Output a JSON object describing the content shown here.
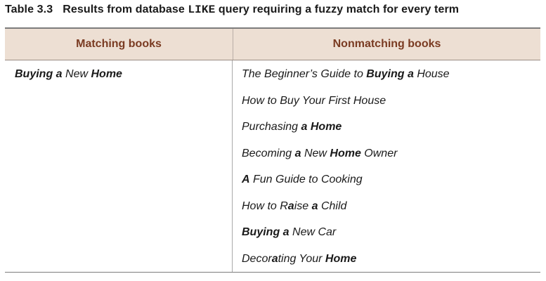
{
  "caption": {
    "number": "Table 3.3",
    "text_before": "Results from database ",
    "code": "LIKE",
    "text_after": " query requiring a fuzzy match for every term"
  },
  "table": {
    "headers": [
      "Matching books",
      "Nonmatching books"
    ],
    "matching": [
      [
        [
          "Buying",
          true
        ],
        [
          " ",
          false
        ],
        [
          "a",
          true
        ],
        [
          " New ",
          false
        ],
        [
          "Home",
          true
        ]
      ]
    ],
    "nonmatching": [
      [
        [
          "The Beginner’s Guide to ",
          false
        ],
        [
          "Buying",
          true
        ],
        [
          " ",
          false
        ],
        [
          "a",
          true
        ],
        [
          " House",
          false
        ]
      ],
      [
        [
          "How to Buy Your First House",
          false
        ]
      ],
      [
        [
          "Purchasing ",
          false
        ],
        [
          "a",
          true
        ],
        [
          " ",
          false
        ],
        [
          "Home",
          true
        ]
      ],
      [
        [
          "Becoming ",
          false
        ],
        [
          "a",
          true
        ],
        [
          " New ",
          false
        ],
        [
          "Home",
          true
        ],
        [
          " Owner",
          false
        ]
      ],
      [
        [
          "A",
          true
        ],
        [
          " Fun Guide to Cooking",
          false
        ]
      ],
      [
        [
          "How to R",
          false
        ],
        [
          "a",
          true
        ],
        [
          "ise ",
          false
        ],
        [
          "a",
          true
        ],
        [
          " Child",
          false
        ]
      ],
      [
        [
          "Buying",
          true
        ],
        [
          " ",
          false
        ],
        [
          "a",
          true
        ],
        [
          " New Car",
          false
        ]
      ],
      [
        [
          "Decor",
          false
        ],
        [
          "a",
          true
        ],
        [
          "ting Your ",
          false
        ],
        [
          "Home",
          true
        ]
      ]
    ]
  }
}
